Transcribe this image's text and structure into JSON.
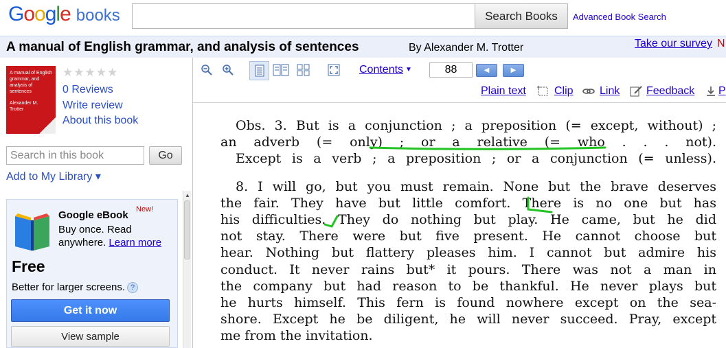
{
  "header": {
    "logo_google": "Google",
    "logo_books": "books",
    "search_value": "",
    "search_button": "Search Books",
    "advanced_link": "Advanced Book Search"
  },
  "titlebar": {
    "title": "A manual of English grammar, and analysis of sentences",
    "author": "By Alexander M. Trotter",
    "survey_link": "Take our survey",
    "survey_suffix": "N"
  },
  "sidebar": {
    "cover_lines": [
      "A manual of English grammar, and analysis of sentences",
      "Alexander M. Trotter"
    ],
    "stars": "★★★★★",
    "rating": 0,
    "reviews_link": "0 Reviews",
    "write_review_link": "Write review",
    "about_link": "About this book",
    "search_placeholder": "Search in this book",
    "go_button": "Go",
    "add_library_link": "Add to My Library ▾"
  },
  "ebook": {
    "title": "Google eBook",
    "badge": "New!",
    "description": "Buy once. Read anywhere.",
    "learn_more": "Learn more",
    "price": "Free",
    "better_text": "Better for larger screens.",
    "help_icon_glyph": "?",
    "get_it_now": "Get it now",
    "view_sample": "View sample"
  },
  "toolbar": {
    "contents_label": "Contents",
    "page_number": "88",
    "prev_glyph": "◀",
    "next_glyph": "▶",
    "links": {
      "plain_text": "Plain text",
      "clip": "Clip",
      "link": "Link",
      "feedback": "Feedback",
      "print": "P"
    },
    "icons": [
      "zoom-out-icon",
      "zoom-in-icon",
      "one-page-icon",
      "two-page-icon",
      "thumbnails-icon",
      "fullscreen-icon"
    ]
  },
  "page": {
    "lines": [
      "Obs. 3. But is a conjunction ; a preposition (= except, without) ;",
      "an adverb (= only) ; or a relative (= who . . . not).",
      "Except is a verb ; a preposition ; or a conjunction (= unless).",
      "",
      "8. I will go, but you must remain. None but the brave deserves",
      "the fair. They have but little comfort. There is no one but has",
      "his difficulties. They do nothing but play. He came, but he did",
      "not stay. There were but five present. He cannot choose but",
      "hear. Nothing but flattery pleases him. I cannot but admire his",
      "conduct. It never rains but* it pours. There was not a man in",
      "the company but had reason to be thankful. He never plays but",
      "he hurts himself. This fern is found nowhere except on the sea-",
      "shore. Except he be diligent, he will never succeed. Pray, except",
      "me from the invitation."
    ],
    "annotation_color": "#22c322"
  },
  "colors": {
    "link": "#2200cc",
    "titlebar_bg": "#ebeff9",
    "primary_button": "#4d90fe",
    "cover": "#c8161b"
  }
}
